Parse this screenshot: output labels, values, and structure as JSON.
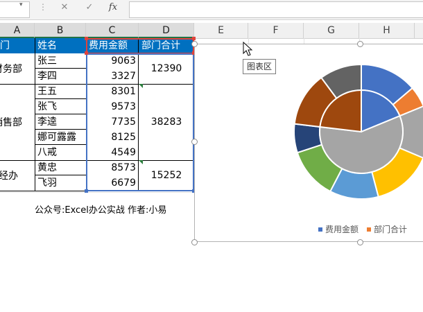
{
  "formula_bar": {
    "namebox_value": "",
    "dropdown_arrow": "▾",
    "separator": "⋮",
    "cancel_glyph": "✕",
    "confirm_glyph": "✓",
    "fx_glyph": "fx",
    "formula_value": ""
  },
  "columns": [
    "A",
    "B",
    "C",
    "D",
    "E",
    "F",
    "G",
    "H"
  ],
  "table": {
    "headers": [
      "门",
      "姓名",
      "费用金额",
      "部门合计"
    ],
    "rows": [
      {
        "name": "张三",
        "amount": "9063"
      },
      {
        "name": "李四",
        "amount": "3327"
      },
      {
        "name": "王五",
        "amount": "8301"
      },
      {
        "name": "张飞",
        "amount": "9573"
      },
      {
        "name": "李逵",
        "amount": "7735"
      },
      {
        "name": "娜可露露",
        "amount": "8125"
      },
      {
        "name": "八戒",
        "amount": "4549"
      },
      {
        "name": "黄忠",
        "amount": "8573"
      },
      {
        "name": "飞羽",
        "amount": "6679"
      }
    ],
    "departments": [
      {
        "label": "财务部",
        "total": "12390"
      },
      {
        "label": "销售部",
        "total": "38283"
      },
      {
        "label": "经办",
        "total": "15252"
      }
    ]
  },
  "footnote": "公众号:Excel办公实战  作者:小易",
  "tooltip": "图表区",
  "colors": {
    "header_fill": "#0070c0",
    "selection_blue": "#4472c4",
    "selection_red": "#e0433c",
    "comment_green": "#2a7d3c",
    "outer_slices": [
      "#4472c4",
      "#ed7d31",
      "#a5a5a5",
      "#ffc000",
      "#5b9bd5",
      "#70ad47",
      "#264478",
      "#9e480e",
      "#636363"
    ],
    "inner_slices": [
      "#4472c4",
      "#a5a5a5",
      "#9e480e"
    ]
  },
  "chart_data": {
    "type": "doughnut",
    "series": [
      {
        "name": "费用金额",
        "values": [
          9063,
          3327,
          8301,
          9573,
          7735,
          8125,
          4549,
          8573,
          6679
        ]
      },
      {
        "name": "部门合计",
        "values": [
          12390,
          38283,
          15252
        ]
      }
    ],
    "legend": [
      "费用金额",
      "部门合计"
    ],
    "legend_position": "bottom-right",
    "legend_colors": [
      "#4472c4",
      "#ed7d31"
    ]
  }
}
